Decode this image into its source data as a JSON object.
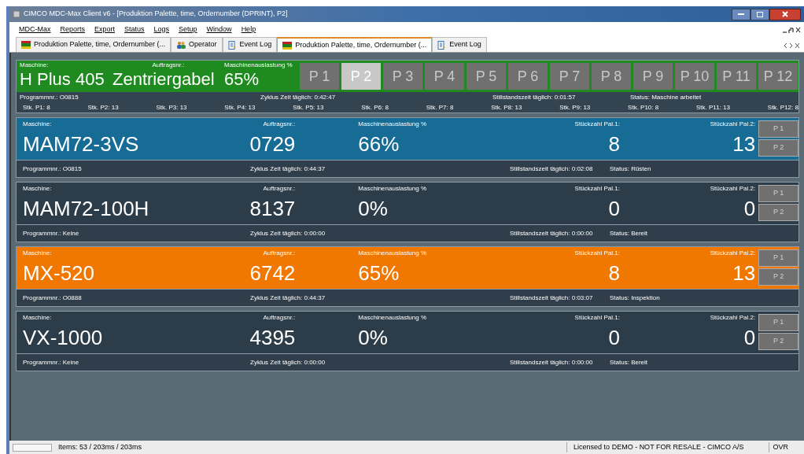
{
  "window": {
    "title": "CIMCO MDC-Max Client v6 - [Produktion Palette, time, Ordernumber (DPRINT), P2]"
  },
  "menu": [
    "MDC-Max",
    "Reports",
    "Export",
    "Status",
    "Logs",
    "Setup",
    "Window",
    "Help"
  ],
  "tabs": [
    {
      "label": "Produktion Palette, time, Ordernumber (...",
      "kind": "grid",
      "selected": false
    },
    {
      "label": "Operator",
      "kind": "people",
      "selected": false
    },
    {
      "label": "Event Log",
      "kind": "log",
      "selected": false
    },
    {
      "label": "Produktion Palette, time, Ordernumber (...",
      "kind": "grid",
      "selected": true
    },
    {
      "label": "Event Log",
      "kind": "log",
      "selected": false
    }
  ],
  "header": {
    "machine_label": "Maschine:",
    "machine": "H Plus 405",
    "order_label": "Auftragsnr.:",
    "order": "Zentriergabel",
    "util_label": "Maschinenauslastung %",
    "util": "65%",
    "pallets": [
      {
        "label": "P 1",
        "selected": false
      },
      {
        "label": "P 2",
        "selected": true
      },
      {
        "label": "P 3",
        "selected": false
      },
      {
        "label": "P 4",
        "selected": false
      },
      {
        "label": "P 5",
        "selected": false
      },
      {
        "label": "P 6",
        "selected": false
      },
      {
        "label": "P 7",
        "selected": false
      },
      {
        "label": "P 8",
        "selected": false
      },
      {
        "label": "P 9",
        "selected": false
      },
      {
        "label": "P 10",
        "selected": false
      },
      {
        "label": "P 11",
        "selected": false
      },
      {
        "label": "P 12",
        "selected": false
      }
    ],
    "program": "Programmnr.: O0815",
    "cycle": "Zyklus Zeit täglich: 0:42:47",
    "idle": "Stillstandszeit täglich: 0:01:57",
    "status": "Status: Maschine arbeitet",
    "counts": [
      "Stk. P1: 8",
      "Stk. P2: 13",
      "Stk. P3: 13",
      "Stk. P4: 13",
      "Stk. P5: 13",
      "Stk. P6: 8",
      "Stk. P7: 8",
      "Stk. P8: 13",
      "Stk. P9: 13",
      "Stk. P10: 8",
      "Stk. P11: 13",
      "Stk. P12: 8"
    ]
  },
  "machines": [
    {
      "color": "#166c94",
      "machine_label": "Maschine:",
      "machine": "MAM72-3VS",
      "order_label": "Auftragsnr.:",
      "order": "0729",
      "util_label": "Maschinenauslastung %",
      "util": "66%",
      "pal1_label": "Stückzahl Pal.1:",
      "pal1": "8",
      "pal2_label": "Stückzahl Pal.2:",
      "pal2": "13",
      "buttons": [
        "P 1",
        "P 2"
      ],
      "program": "Programmnr.: O0815",
      "cycle": "Zyklus Zeit täglich: 0:44:37",
      "idle": "Stillstandszeit täglich: 0:02:08",
      "status": "Status: Rüsten"
    },
    {
      "color": "#2c3c48",
      "machine_label": "Maschine:",
      "machine": "MAM72-100H",
      "order_label": "Auftragsnr.:",
      "order": "8137",
      "util_label": "Maschinenauslastung %",
      "util": "0%",
      "pal1_label": "Stückzahl Pal.1:",
      "pal1": "0",
      "pal2_label": "Stückzahl Pal.2:",
      "pal2": "0",
      "buttons": [
        "P 1",
        "P 2"
      ],
      "program": "Programmnr.: Keine",
      "cycle": "Zyklus Zeit täglich: 0:00:00",
      "idle": "Stillstandszeit täglich: 0:00:00",
      "status": "Status: Bereit"
    },
    {
      "color": "#f07800",
      "machine_label": "Maschine:",
      "machine": "MX-520",
      "order_label": "Auftragsnr.:",
      "order": "6742",
      "util_label": "Maschinenauslastung %",
      "util": "65%",
      "pal1_label": "Stückzahl Pal.1:",
      "pal1": "8",
      "pal2_label": "Stückzahl Pal.2:",
      "pal2": "13",
      "buttons": [
        "P 1",
        "P 2"
      ],
      "program": "Programmnr.: O0888",
      "cycle": "Zyklus Zeit täglich: 0:44:37",
      "idle": "Stillstandszeit täglich: 0:03:07",
      "status": "Status: Inspektion"
    },
    {
      "color": "#2c3c48",
      "machine_label": "Maschine:",
      "machine": "VX-1000",
      "order_label": "Auftragsnr.:",
      "order": "4395",
      "util_label": "Maschinenauslastung %",
      "util": "0%",
      "pal1_label": "Stückzahl Pal.1:",
      "pal1": "0",
      "pal2_label": "Stückzahl Pal.2:",
      "pal2": "0",
      "buttons": [
        "P 1",
        "P 2"
      ],
      "program": "Programmnr.: Keine",
      "cycle": "Zyklus Zeit täglich: 0:00:00",
      "idle": "Stillstandszeit täglich: 0:00:00",
      "status": "Status: Bereit"
    }
  ],
  "status_bar": {
    "items": "Items: 53 / 203ms / 203ms",
    "license": "Licensed to DEMO - NOT FOR RESALE - CIMCO A/S",
    "mode": "OVR"
  }
}
